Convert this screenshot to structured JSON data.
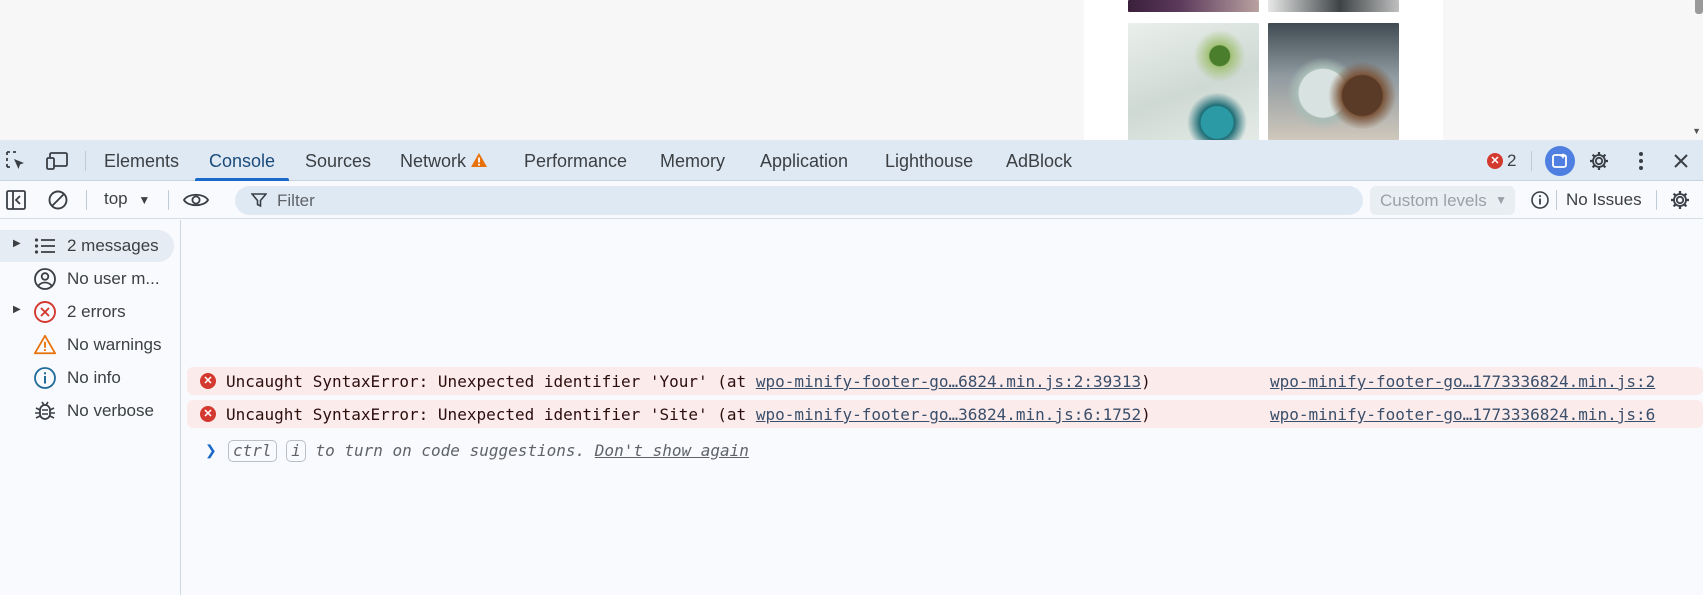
{
  "tabs": [
    {
      "label": "Elements"
    },
    {
      "label": "Console"
    },
    {
      "label": "Sources"
    },
    {
      "label": "Network"
    },
    {
      "label": "Performance"
    },
    {
      "label": "Memory"
    },
    {
      "label": "Application"
    },
    {
      "label": "Lighthouse"
    },
    {
      "label": "AdBlock"
    }
  ],
  "active_tab": "Console",
  "error_count": "2",
  "toolbar": {
    "context": "top",
    "filter_placeholder": "Filter",
    "levels": "Custom levels",
    "issues": "No Issues"
  },
  "sidebar": [
    {
      "label": "2 messages",
      "icon": "list-icon"
    },
    {
      "label": "No user m...",
      "icon": "user-icon"
    },
    {
      "label": "2 errors",
      "icon": "error-icon"
    },
    {
      "label": "No warnings",
      "icon": "warning-icon"
    },
    {
      "label": "No info",
      "icon": "info-icon"
    },
    {
      "label": "No verbose",
      "icon": "bug-icon"
    }
  ],
  "messages": [
    {
      "prefix": "Uncaught SyntaxError: Unexpected identifier 'Your' (at ",
      "link": "wpo-minify-footer-go…6824.min.js:2:39313",
      "suffix": ")",
      "source": "wpo-minify-footer-go…1773336824.min.js:2"
    },
    {
      "prefix": "Uncaught SyntaxError: Unexpected identifier 'Site' (at ",
      "link": "wpo-minify-footer-go…36824.min.js:6:1752",
      "suffix": ")",
      "source": "wpo-minify-footer-go…1773336824.min.js:6"
    }
  ],
  "hint": {
    "key1": "ctrl",
    "key2": "i",
    "text": " to turn on code suggestions. ",
    "dont_show": "Don't show again"
  },
  "colors": {
    "accent": "#1b6ac9",
    "error": "#d3392f",
    "warning": "#e8710a"
  }
}
